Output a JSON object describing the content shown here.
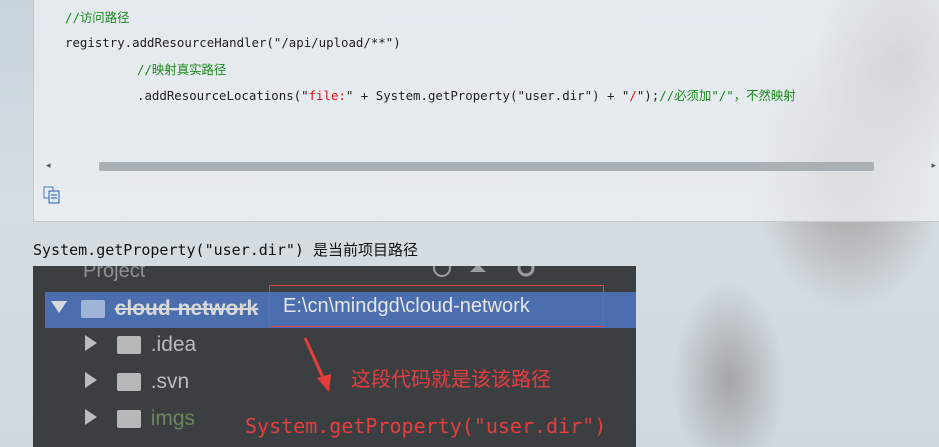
{
  "code_block": {
    "lines": [
      {
        "comment": "//访问路径"
      },
      {
        "code": "registry.addResourceHandler(\"/api/upload/**\")"
      },
      {
        "comment": "//映射真实路径"
      },
      {
        "pre": ".addResourceLocations(\"",
        "str1": "file:",
        "mid": "\" + System.getProperty(\"user.dir\") + \"",
        "str2": "/",
        "post": "\");",
        "comment": "//必须加\"/\"，不然映射"
      }
    ],
    "scroll_left": "◂",
    "scroll_right": "▸",
    "copy_icon": "copy-icon"
  },
  "caption": "System.getProperty(\"user.dir\") 是当前项目路径",
  "screenshot": {
    "panel_title": "Project",
    "tree": [
      {
        "label": "cloud-network",
        "selected": true
      },
      {
        "label": ".idea"
      },
      {
        "label": ".svn"
      },
      {
        "label": "imgs"
      }
    ],
    "path_text": "E:\\cn\\mindgd\\cloud-network",
    "annotation": "这段代码就是该该路径",
    "annotation_code": "System.getProperty(\"user.dir\")",
    "colors": {
      "selection": "#4b6eaf",
      "annotation": "#e83d3d",
      "imgs_folder": "#6a8759"
    }
  }
}
